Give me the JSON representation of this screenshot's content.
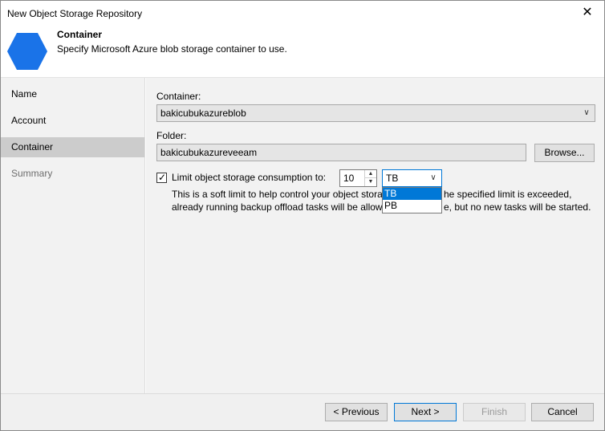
{
  "window": {
    "title": "New Object Storage Repository",
    "close_glyph": "✕"
  },
  "header": {
    "title": "Container",
    "description": "Specify Microsoft Azure blob storage container to use.",
    "icon_color": "#1a73e8"
  },
  "sidebar": {
    "items": [
      {
        "label": "Name"
      },
      {
        "label": "Account"
      },
      {
        "label": "Container"
      },
      {
        "label": "Summary"
      }
    ]
  },
  "form": {
    "container_label": "Container:",
    "container_value": "bakicubukazureblob",
    "folder_label": "Folder:",
    "folder_value": "bakicubukazureveeam",
    "browse_label": "Browse...",
    "limit_label": "Limit object storage consumption to:",
    "limit_checked": true,
    "limit_value": "10",
    "unit_selected": "TB",
    "unit_options": [
      "TB",
      "PB"
    ],
    "note_line1_a": "This is a soft limit to help control your object stora",
    "note_line1_b": "he specified limit is exceeded,",
    "note_line2_a": "already running backup offload tasks will be allow",
    "note_line2_b": "e, but no new tasks will be started."
  },
  "footer": {
    "previous_label": "< Previous",
    "next_label": "Next >",
    "finish_label": "Finish",
    "cancel_label": "Cancel"
  }
}
